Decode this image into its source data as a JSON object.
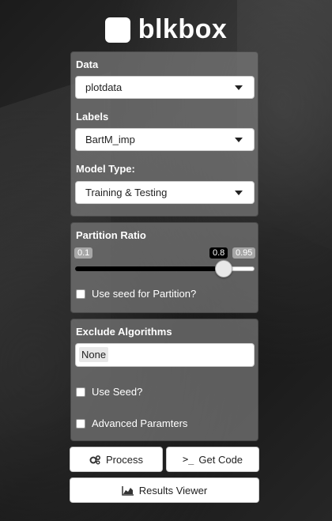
{
  "brand": {
    "name": "blkbox"
  },
  "data_panel": {
    "data": {
      "label": "Data",
      "value": "plotdata"
    },
    "labels": {
      "label": "Labels",
      "value": "BartM_imp"
    },
    "model_type": {
      "label": "Model Type:",
      "value": "Training & Testing"
    }
  },
  "partition_panel": {
    "title": "Partition Ratio",
    "slider": {
      "min": 0.1,
      "max": 0.95,
      "value": 0.8
    },
    "min_label": "0.1",
    "max_label": "0.95",
    "value_label": "0.8",
    "seed_checkbox": {
      "label": "Use seed for Partition?",
      "checked": false
    }
  },
  "exclude_panel": {
    "title": "Exclude Algorithms",
    "selected": "None",
    "use_seed": {
      "label": "Use Seed?",
      "checked": false
    },
    "advanced": {
      "label": "Advanced Paramters",
      "checked": false
    }
  },
  "actions": {
    "process": "Process",
    "get_code": "Get Code",
    "results_viewer": "Results Viewer"
  },
  "icons": {
    "process": "gears-icon",
    "get_code": "terminal-icon",
    "results_viewer": "area-chart-icon"
  }
}
